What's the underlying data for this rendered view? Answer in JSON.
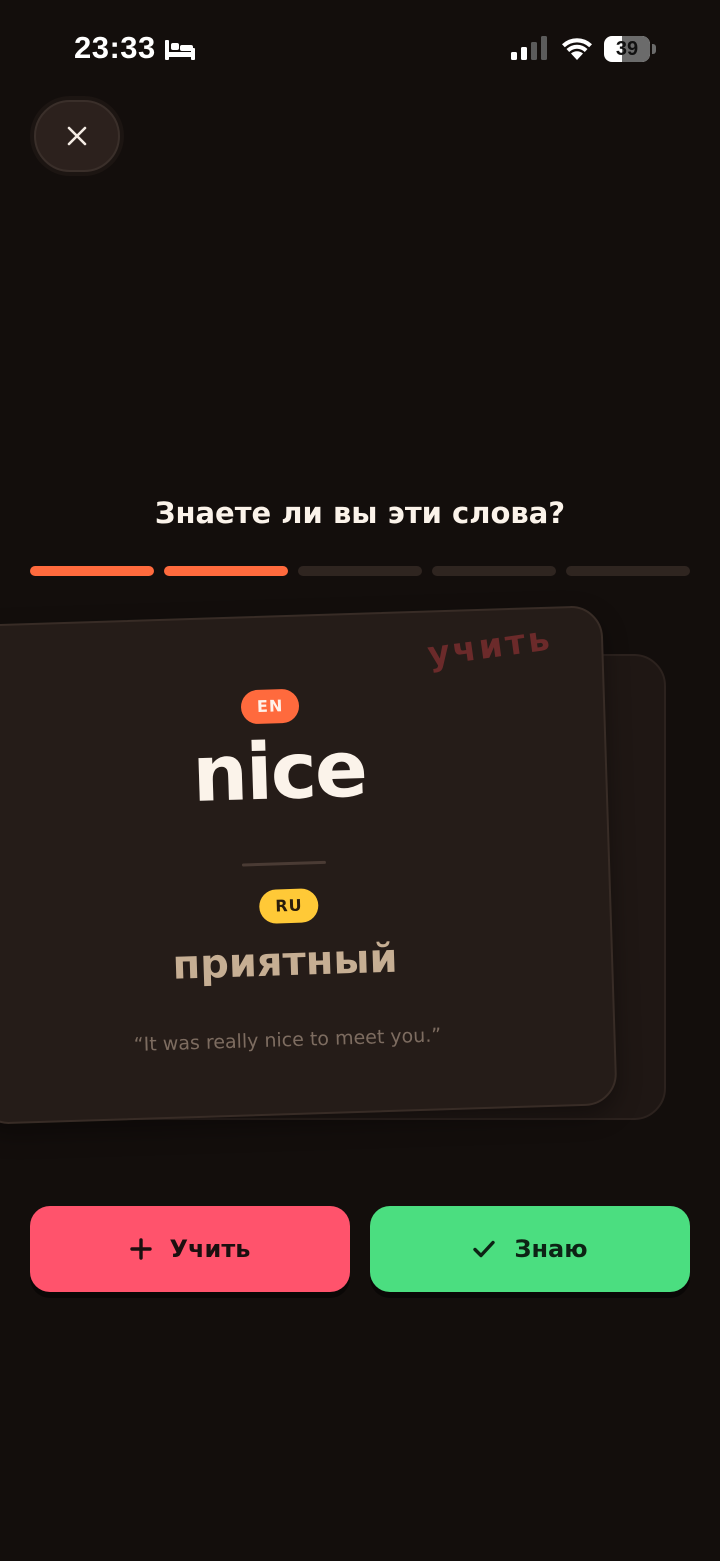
{
  "status_bar": {
    "time": "23:33",
    "battery_level": "39",
    "battery_fraction": 0.39,
    "icons": [
      "bed-icon",
      "cellular-signal-icon",
      "wifi-icon",
      "battery-icon"
    ]
  },
  "header": {
    "close_icon": "close-icon"
  },
  "quiz": {
    "title": "Знаете ли вы эти слова?",
    "progress": {
      "total_steps": 5,
      "completed_steps": 2
    }
  },
  "card": {
    "stamp": "учить",
    "source_lang": "EN",
    "word": "nice",
    "target_lang": "RU",
    "translation": "приятный",
    "example": "“It was really nice to meet you.”"
  },
  "actions": {
    "learn_label": "Учить",
    "learn_icon": "plus-icon",
    "know_label": "Знаю",
    "know_icon": "check-icon"
  },
  "colors": {
    "background": "#130e0c",
    "accent_orange": "#ff6a3d",
    "badge_yellow": "#ffc937",
    "learn_button": "#ff536c",
    "know_button": "#4bde80",
    "stamp_red": "#6b2a2a"
  }
}
